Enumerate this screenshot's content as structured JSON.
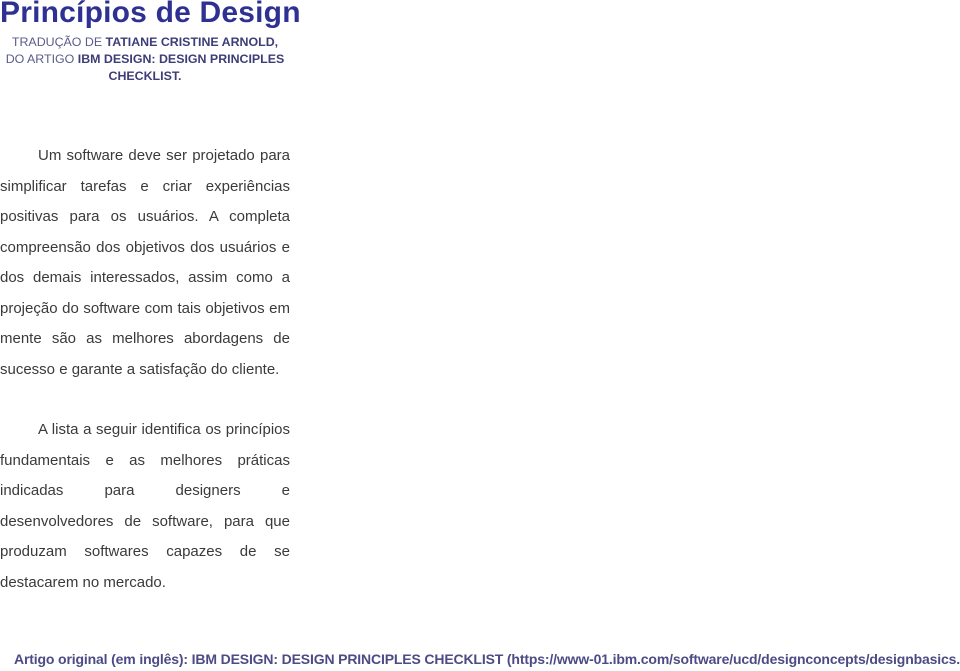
{
  "document": {
    "title": "Princípios de Design",
    "subtitle": {
      "prefix_1": "TRADUÇÃO DE ",
      "translator": "TATIANE CRISTINE ARNOLD,",
      "prefix_2": "DO ARTIGO ",
      "article": "IBM DESIGN: DESIGN PRINCIPLES CHECKLIST."
    },
    "paragraphs": [
      "Um software deve ser projetado para simplificar tarefas e criar experiências positivas para os usuários. A completa compreensão dos objetivos dos usuários e dos demais interessados, assim como a projeção do software com tais objetivos em mente são as melhores abordagens de sucesso e garante a satisfação do cliente.",
      "A lista a seguir identifica os princípios fundamentais e as melhores práticas indicadas para designers e desenvolvedores de software, para que produzam softwares capazes de se destacarem no mercado."
    ],
    "footer": "Artigo original (em inglês): IBM DESIGN: DESIGN PRINCIPLES CHECKLIST (https://www-01.ibm.com/software/ucd/designconcepts/designbasics.html)"
  },
  "colors": {
    "title": "#2e3192",
    "subtitle": "#5a5a8c",
    "body": "#3a3a3a",
    "footer": "#4b4b86"
  }
}
